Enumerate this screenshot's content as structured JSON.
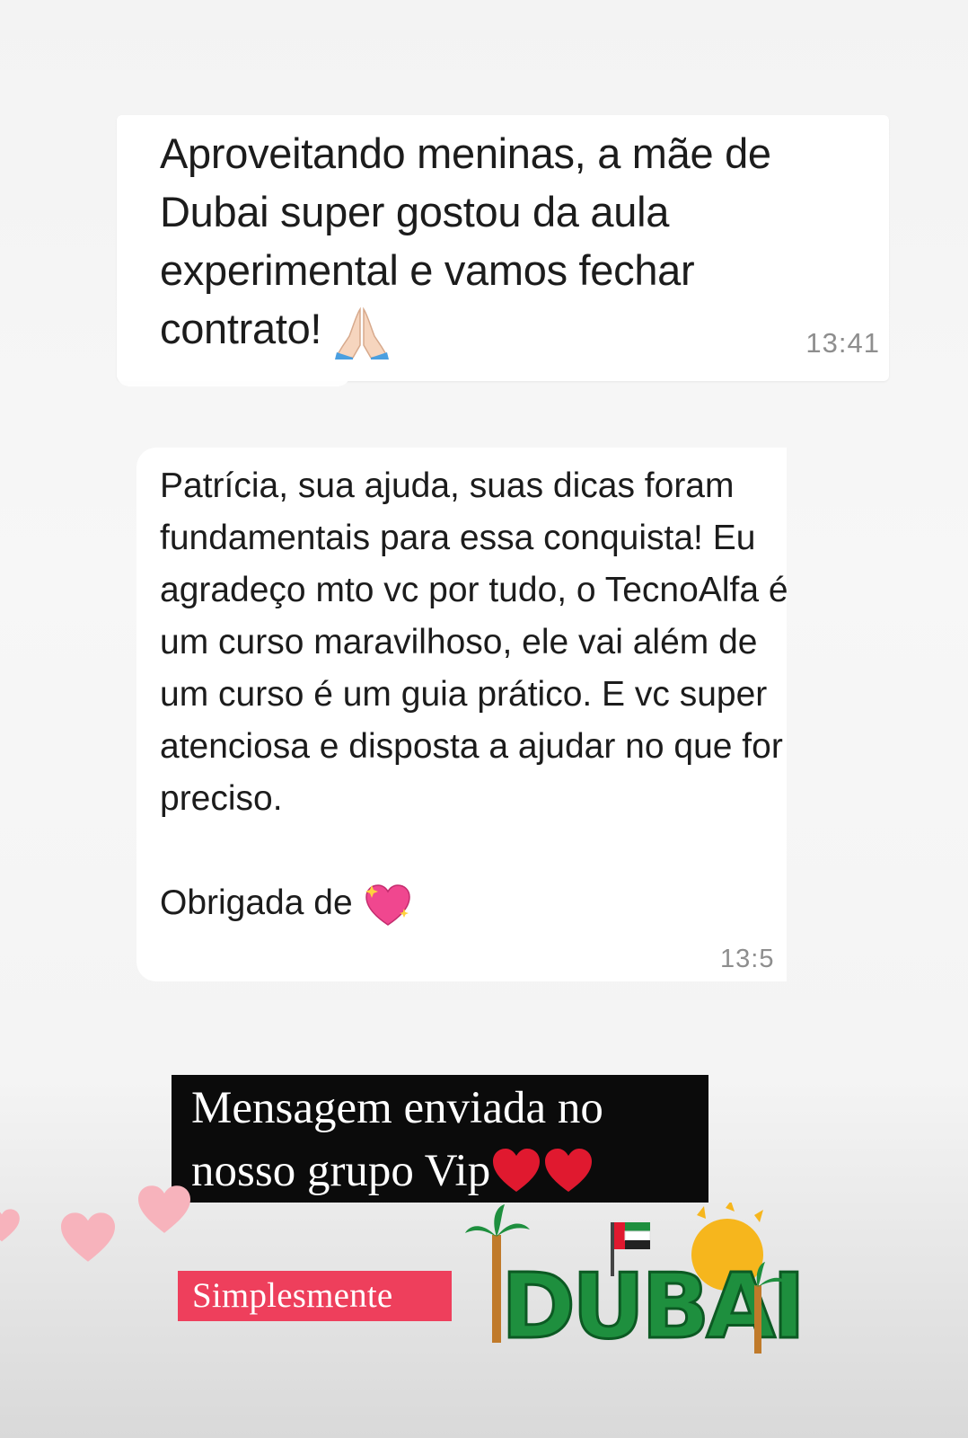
{
  "messages": [
    {
      "text": "Aproveitando meninas, a mãe de Dubai super gostou da aula experimental e vamos fechar contrato!",
      "emoji": "folded-hands",
      "time": "13:41"
    },
    {
      "text": "Patrícia, sua ajuda, suas dicas foram fundamentais para essa conquista! Eu agradeço mto vc por tudo, o TecnoAlfa é um curso maravilhoso, ele vai além de um curso é um guia prático. E vc super atenciosa e disposta a ajudar no que for preciso.",
      "closing": "Obrigada de",
      "emoji": "sparkling-heart",
      "time": "13:5"
    }
  ],
  "caption": {
    "line1": "Mensagem enviada no",
    "line2": "nosso grupo Vip"
  },
  "label": "Simplesmente",
  "sticker": {
    "text": "DUBAI"
  },
  "colors": {
    "label_bg": "#ee3f5c",
    "caption_bg": "#0b0b0b",
    "heart_red": "#e0192f",
    "pink_heart": "#f7b3bc",
    "sticker_green": "#1e8f3e"
  }
}
